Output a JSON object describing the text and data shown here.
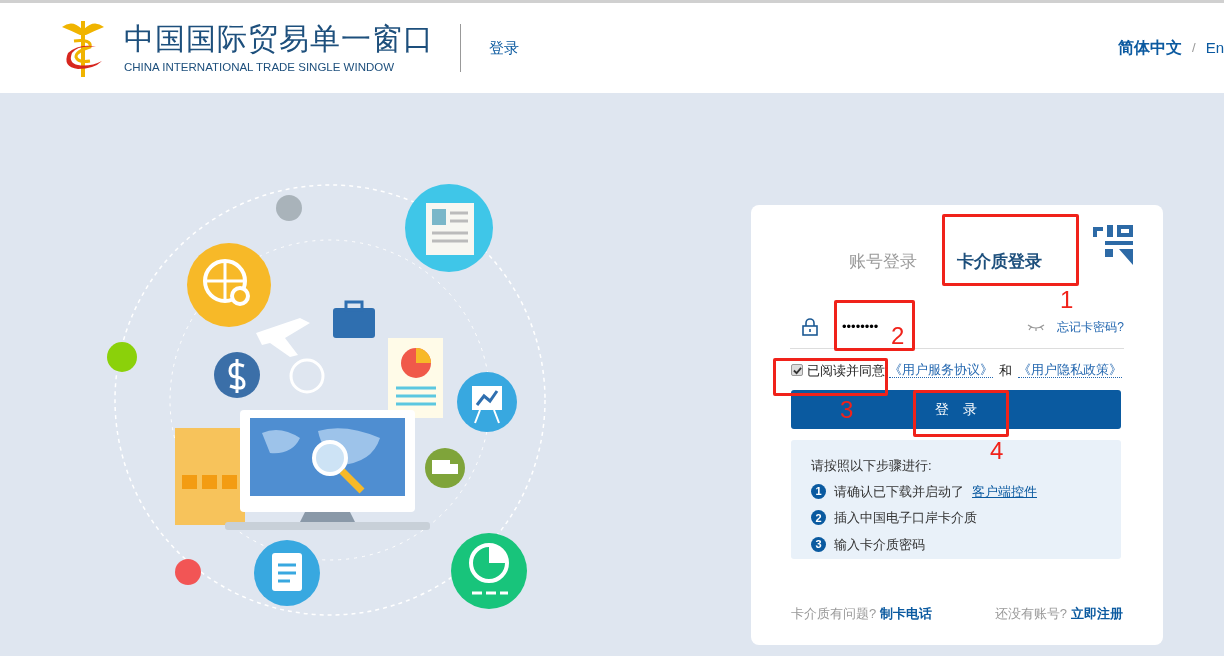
{
  "header": {
    "logo_title": "中国国际贸易单一窗口",
    "logo_subtitle": "CHINA INTERNATIONAL TRADE SINGLE WINDOW",
    "nav_link": "登录",
    "languages": [
      {
        "label": "简体中文",
        "selected": true
      },
      {
        "label": "En",
        "selected": false
      }
    ],
    "language_separator": "/"
  },
  "login_card": {
    "tabs": [
      {
        "label": "账号登录",
        "selected": false
      },
      {
        "label": "卡介质登录",
        "selected": true
      }
    ],
    "password": {
      "value": "••••••••"
    },
    "forgot_link": "忘记卡密码?",
    "agreement": {
      "checked": true,
      "text": "已阅读并同意",
      "links": [
        "《用户服务协议》",
        "《用户隐私政策》"
      ],
      "conjunction": "和"
    },
    "submit_button": "登　录",
    "steps": {
      "title": "请按照以下步骤进行:",
      "items": [
        {
          "number": "1",
          "text": "请确认已下载并启动了",
          "link": "客户端控件"
        },
        {
          "number": "2",
          "text": "插入中国电子口岸卡介质"
        },
        {
          "number": "3",
          "text": "输入卡介质密码"
        }
      ]
    },
    "footer": {
      "left_text": "卡介质有问题?",
      "left_link": "制卡电话",
      "right_text": "还没有账号?",
      "right_link": "立即注册"
    }
  },
  "annotations": [
    {
      "number": "1"
    },
    {
      "number": "2"
    },
    {
      "number": "3"
    },
    {
      "number": "4"
    }
  ]
}
